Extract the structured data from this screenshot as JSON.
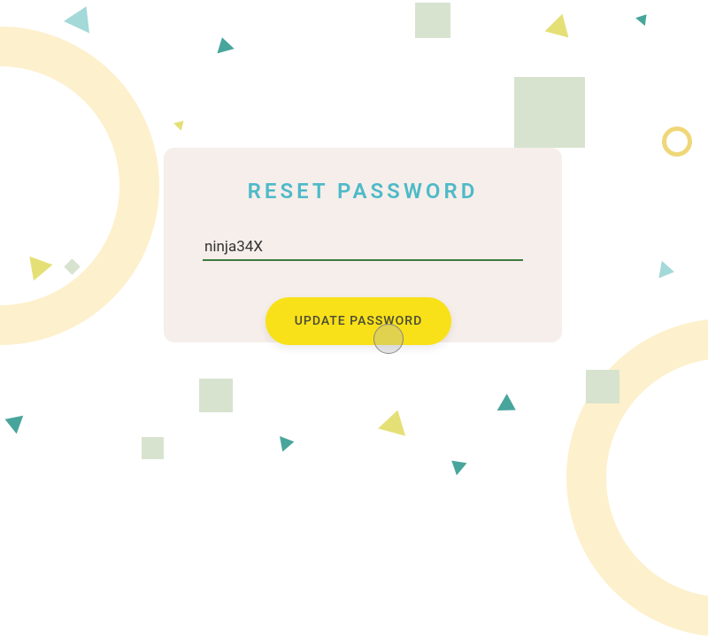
{
  "card": {
    "title": "RESET PASSWORD",
    "password_value": "ninja34X",
    "password_placeholder": ""
  },
  "actions": {
    "update_label": "UPDATE PASSWORD"
  },
  "colors": {
    "accent_teal": "#4dbac8",
    "button_yellow": "#f8e118",
    "input_underline": "#3c7a3f",
    "card_bg": "#f6eeea"
  }
}
